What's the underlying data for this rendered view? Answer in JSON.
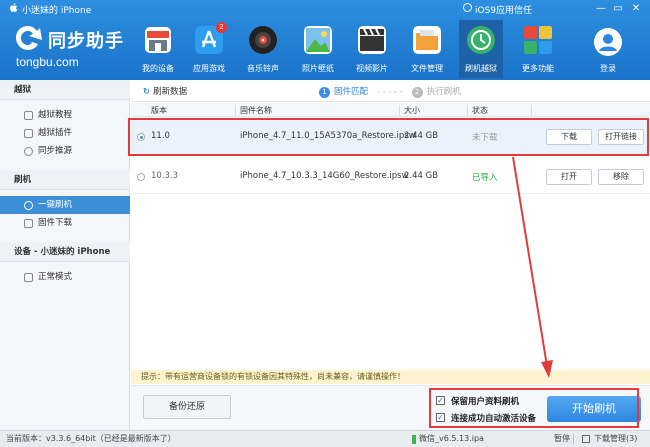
{
  "titlebar": {
    "device_name": "小迷妹的 iPhone",
    "ios_trust": "iOS9应用信任",
    "minimize": "—",
    "restore": "▭",
    "close": "✕"
  },
  "logo": {
    "name": "同步助手",
    "url": "tongbu.com"
  },
  "nav": [
    {
      "label": "我的设备",
      "icon": "store-icon",
      "color": "#e8493a"
    },
    {
      "label": "应用游戏",
      "icon": "app-store-icon",
      "color": "#2d9df0",
      "badge": "2"
    },
    {
      "label": "音乐铃声",
      "icon": "music-disc-icon",
      "color": "#222222"
    },
    {
      "label": "照片壁纸",
      "icon": "photo-icon",
      "color": "#4db848"
    },
    {
      "label": "视频影片",
      "icon": "clapper-icon",
      "color": "#333333"
    },
    {
      "label": "文件管理",
      "icon": "folder-icon",
      "color": "#f2a23a"
    },
    {
      "label": "刷机越狱",
      "icon": "flash-icon",
      "color": "#38b26a"
    },
    {
      "label": "更多功能",
      "icon": "grid-icon",
      "color": "#e8493a"
    }
  ],
  "login": "登录",
  "sidebar": {
    "sections": [
      {
        "title": "越狱",
        "items": [
          "越狱教程",
          "越狱插件",
          "同步推源"
        ]
      },
      {
        "title": "刷机",
        "items": [
          "一键刷机",
          "固件下载"
        ]
      },
      {
        "title": "设备 - 小迷妹的 iPhone",
        "items": [
          "正常模式"
        ]
      }
    ]
  },
  "toolbar": {
    "refresh": "刷新数据",
    "step1_num": "1",
    "step1": "固件匹配",
    "step2_num": "2",
    "step2": "执行刷机"
  },
  "table": {
    "headers": [
      "版本",
      "固件名称",
      "大小",
      "状态"
    ],
    "rows": [
      {
        "version": "11.0",
        "name": "iPhone_4.7_11.0_15A5370a_Restore.ipsw",
        "size": "2.44 GB",
        "status": "未下载",
        "status_color": "#999999",
        "btn1": "下载",
        "btn2": "打开链接"
      },
      {
        "version": "10.3.3",
        "name": "iPhone_4.7_10.3.3_14G60_Restore.ipsw",
        "size": "2.44 GB",
        "status": "已导入",
        "status_color": "#27a844",
        "btn1": "打开",
        "btn2": "移除"
      }
    ]
  },
  "tip": "提示：带有运营商设备锁的有锁设备因其特殊性，尚未兼容，请谨慎操作！",
  "bottom": {
    "backup": "备份还原",
    "opt1": "保留用户资料刷机",
    "opt2": "连接成功自动激活设备",
    "start": "开始刷机"
  },
  "status": {
    "version": "当前版本：v3.3.6_64bit（已经是最新版本了）",
    "download_item": "微信_v6.5.13.ipa",
    "pause": "暂停",
    "download_mgr": "下载管理(3)"
  },
  "colors": {
    "accent": "#2d86e0",
    "header": "#1a73c9",
    "highlight": "#e23b3b"
  }
}
